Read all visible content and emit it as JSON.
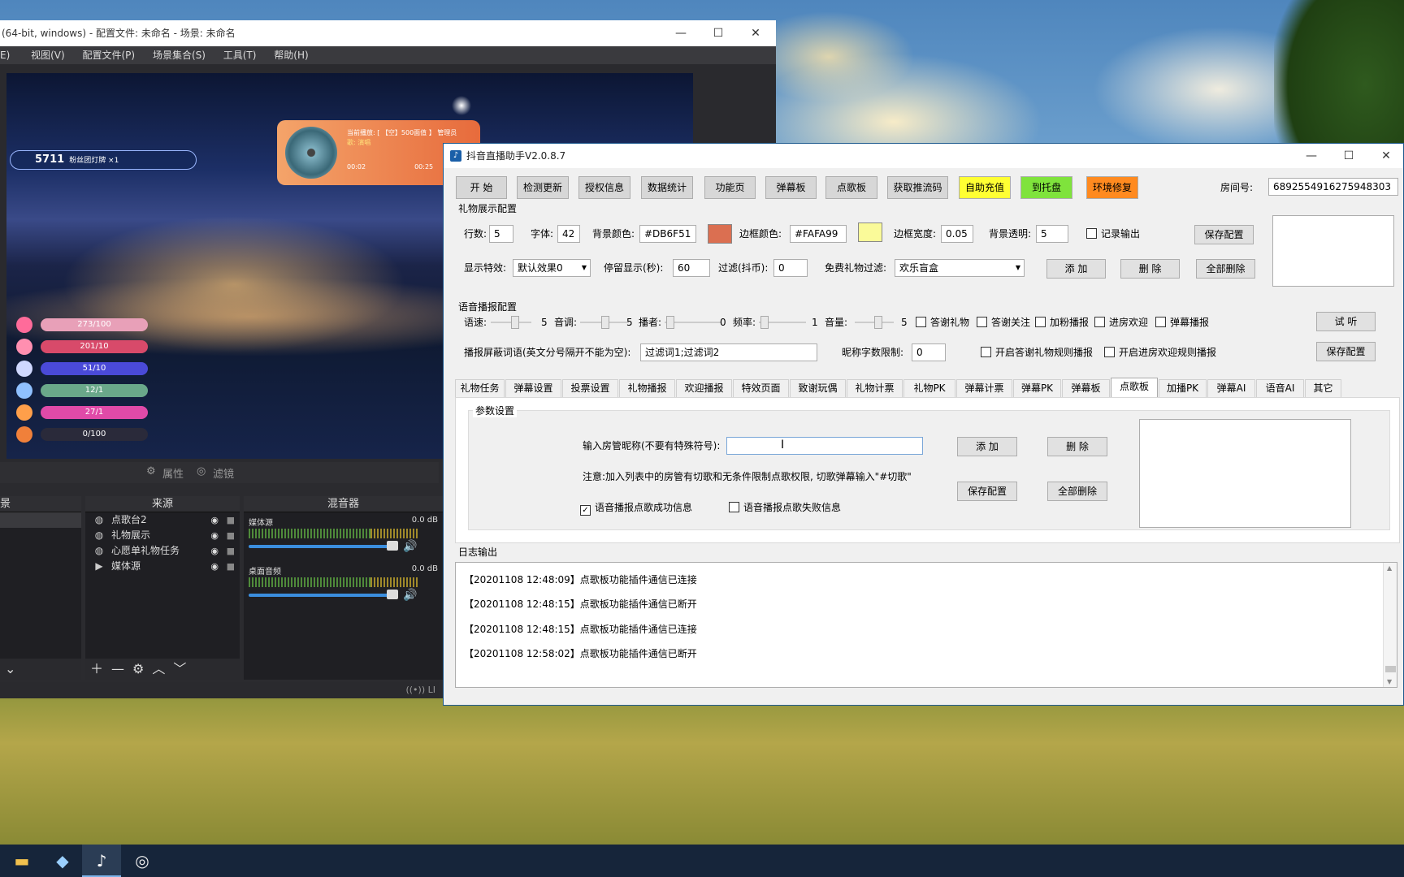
{
  "obs": {
    "title": "(64-bit, windows) - 配置文件: 未命名 - 场景: 未命名",
    "menu": [
      "E)",
      "视图(V)",
      "配置文件(P)",
      "场景集合(S)",
      "工具(T)",
      "帮助(H)"
    ],
    "preview": {
      "fan_count": "5711",
      "fan_label": "粉丝团灯牌 ×1",
      "song_line1": "当前播放: [ 【空】500面值 】 管理员",
      "song_line2": "歌: 演唱",
      "song_time_start": "00:02",
      "song_time_end": "00:25",
      "bars": [
        {
          "text": "273/100",
          "color": "#e8a0b8"
        },
        {
          "text": "201/10",
          "color": "#d84a6a"
        },
        {
          "text": "51/10",
          "color": "#4a4ad8"
        },
        {
          "text": "12/1",
          "color": "#6aa88a"
        },
        {
          "text": "27/1",
          "color": "#e04aa8"
        },
        {
          "text": "0/100",
          "color": "#2a2a3a"
        }
      ]
    },
    "props_label": "属性",
    "filter_label": "滤镜",
    "scene_dock_title": "景",
    "sources_dock_title": "来源",
    "mixer_dock_title": "混音器",
    "sources": [
      {
        "name": "点歌台2",
        "icon": "globe-icon"
      },
      {
        "name": "礼物展示",
        "icon": "globe-icon"
      },
      {
        "name": "心愿单礼物任务",
        "icon": "globe-icon"
      },
      {
        "name": "媒体源",
        "icon": "play-icon"
      }
    ],
    "mixer": [
      {
        "name": "媒体源",
        "level": "0.0 dB"
      },
      {
        "name": "桌面音频",
        "level": "0.0 dB"
      }
    ],
    "meter_scale": "-60 -55 -50 -45 -40 -35 -30 -25 -20 -15 -10 -5",
    "status_text": "LI"
  },
  "app": {
    "title": "抖音直播助手V2.0.8.7",
    "toolbar": [
      "开 始",
      "检测更新",
      "授权信息",
      "数据统计",
      "功能页",
      "弹幕板",
      "点歌板",
      "获取推流码",
      "自助充值",
      "到托盘",
      "环境修复"
    ],
    "room_label": "房间号:",
    "room_value": "6892554916275948303",
    "gift_group": {
      "title": "礼物展示配置",
      "rows_label": "行数:",
      "rows_value": "5",
      "font_label": "字体:",
      "font_value": "42",
      "bg_color_label": "背景颜色:",
      "bg_color_value": "#DB6F51",
      "border_color_label": "边框颜色:",
      "border_color_value": "#FAFA99",
      "border_width_label": "边框宽度:",
      "border_width_value": "0.05",
      "bg_opacity_label": "背景透明:",
      "bg_opacity_value": "5",
      "record_output": "记录输出",
      "save_config": "保存配置",
      "effect_label": "显示特效:",
      "effect_value": "默认效果0",
      "stay_label": "停留显示(秒):",
      "stay_value": "60",
      "filter_label": "过滤(抖币):",
      "filter_value": "0",
      "free_filter_label": "免费礼物过滤:",
      "free_filter_value": "欢乐盲盒",
      "add": "添 加",
      "delete": "删 除",
      "delete_all": "全部删除"
    },
    "voice_group": {
      "title": "语音播报配置",
      "speed_label": "语速:",
      "speed_value": "5",
      "pitch_label": "音调:",
      "pitch_value": "5",
      "speaker_label": "播者:",
      "speaker_value": "0",
      "freq_label": "频率:",
      "freq_value": "1",
      "volume_label": "音量:",
      "volume_value": "5",
      "checks": [
        "答谢礼物",
        "答谢关注",
        "加粉播报",
        "进房欢迎",
        "弹幕播报"
      ],
      "listen": "试 听",
      "block_label": "播报屏蔽词语(英文分号隔开不能为空):",
      "block_value": "过滤词1;过滤词2",
      "nick_limit_label": "昵称字数限制:",
      "nick_limit_value": "0",
      "rule_gift": "开启答谢礼物规则播报",
      "rule_welcome": "开启进房欢迎规则播报",
      "save_config": "保存配置"
    },
    "tabs": [
      "礼物任务",
      "弹幕设置",
      "投票设置",
      "礼物播报",
      "欢迎播报",
      "特效页面",
      "致谢玩偶",
      "礼物计票",
      "礼物PK",
      "弹幕计票",
      "弹幕PK",
      "弹幕板",
      "点歌板",
      "加播PK",
      "弹幕AI",
      "语音AI",
      "其它"
    ],
    "active_tab": "点歌板",
    "params": {
      "title": "参数设置",
      "admin_label": "输入房管昵称(不要有特殊符号):",
      "admin_value": "",
      "add": "添 加",
      "delete": "删 除",
      "note": "注意:加入列表中的房管有切歌和无条件限制点歌权限, 切歌弹幕输入\"#切歌\"",
      "save_config": "保存配置",
      "delete_all": "全部删除",
      "voice_success": "语音播报点歌成功信息",
      "voice_fail": "语音播报点歌失败信息"
    },
    "log": {
      "title": "日志输出",
      "lines": [
        "【20201108 12:48:09】点歌板功能插件通信已连接",
        "【20201108 12:48:15】点歌板功能插件通信已断开",
        "【20201108 12:48:15】点歌板功能插件通信已连接",
        "【20201108 12:58:02】点歌板功能插件通信已断开"
      ]
    }
  },
  "colors": {
    "bg_swatch": "#DB6F51",
    "border_swatch": "#FAFA99",
    "title_accent": "#1e5a8e"
  }
}
